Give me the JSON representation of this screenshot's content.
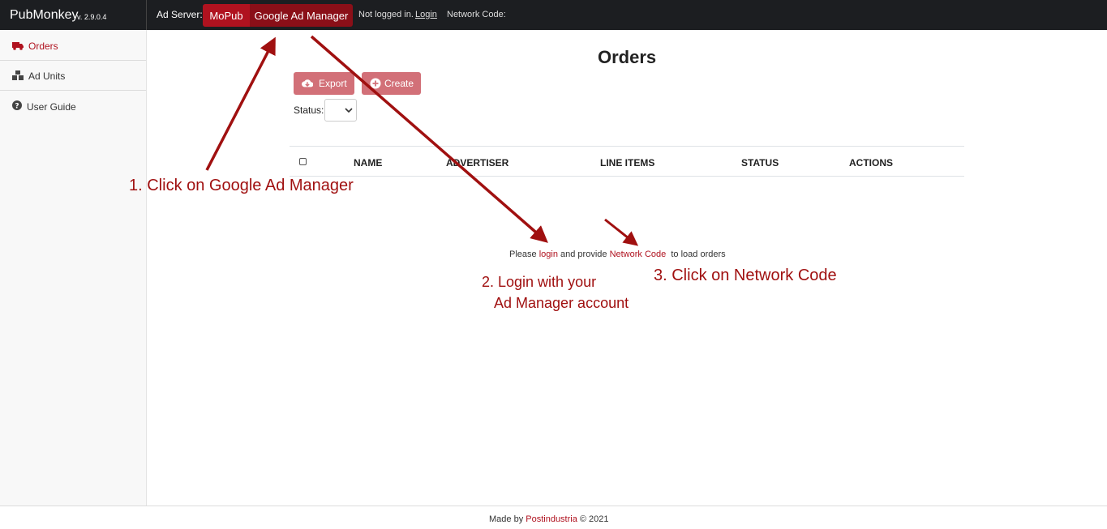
{
  "brand": {
    "name": "PubMonkey",
    "version": "v. 2.9.0.4"
  },
  "topbar": {
    "ad_server_label": "Ad Server:",
    "mopub_label": "MoPub",
    "gam_label": "Google Ad Manager",
    "login_status": "Not logged in.",
    "login_link": "Login",
    "network_code_label": "Network Code:"
  },
  "sidebar": {
    "items": [
      {
        "label": "Orders",
        "icon": "truck-icon"
      },
      {
        "label": "Ad Units",
        "icon": "cubes-icon"
      },
      {
        "label": "User Guide",
        "icon": "question-circle-icon"
      }
    ]
  },
  "main": {
    "title": "Orders",
    "export_label": "Export",
    "create_label": "Create",
    "status_label": "Status:",
    "status_value": "",
    "table": {
      "columns": [
        "NAME",
        "ADVERTISER",
        "LINE ITEMS",
        "STATUS",
        "ACTIONS"
      ]
    },
    "message": {
      "part1": "Please ",
      "login": "login",
      "part2": " and provide ",
      "network_code": "Network Code",
      "part3": "  to load orders"
    }
  },
  "annotations": {
    "step1": "1. Click on Google Ad Manager",
    "step2_line1": "2. Login with your",
    "step2_line2": "Ad Manager account",
    "step3": "3. Click on Network Code"
  },
  "footer": {
    "prefix": "Made by ",
    "link": "Postindustria",
    "suffix": " © 2021"
  },
  "colors": {
    "accent": "#b0121f",
    "accent_dark": "#8a0f18",
    "button_muted": "#d27078",
    "topbar": "#1c1e21",
    "annotation": "#a01010"
  }
}
